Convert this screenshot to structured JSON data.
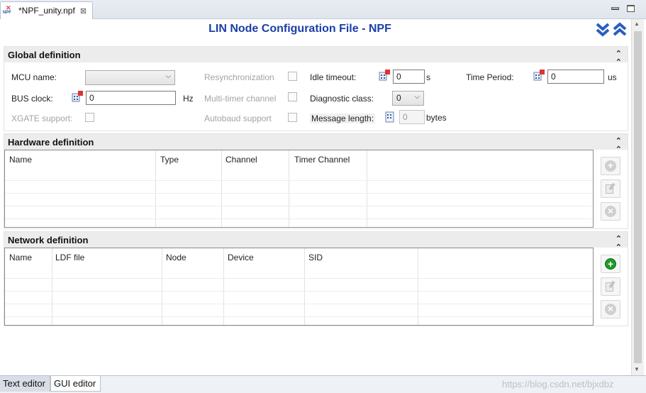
{
  "editor_tab": {
    "title": "*NPF_unity.npf",
    "icon_top": "✕",
    "icon_bottom": "NPF"
  },
  "header": {
    "title": "LIN Node Configuration File - NPF"
  },
  "global": {
    "title": "Global definition",
    "mcu_name_label": "MCU name:",
    "mcu_name_value": "",
    "bus_clock_label": "BUS clock:",
    "bus_clock_value": "0",
    "bus_clock_unit": "Hz",
    "xgate_label": "XGATE support:",
    "resync_label": "Resynchronization",
    "multitimer_label": "Multi-timer channel",
    "autobaud_label": "Autobaud support",
    "idle_label": "Idle timeout:",
    "idle_value": "0",
    "idle_unit": "s",
    "diag_label": "Diagnostic class:",
    "diag_value": "0",
    "msglen_label": "Message length:",
    "msglen_value": "0",
    "msglen_unit": "bytes",
    "time_period_label": "Time Period:",
    "time_period_value": "0",
    "time_period_unit": "us"
  },
  "hardware": {
    "title": "Hardware definition",
    "columns": [
      "Name",
      "Type",
      "Channel",
      "Timer Channel"
    ]
  },
  "network": {
    "title": "Network definition",
    "columns": [
      "Name",
      "LDF file",
      "Node",
      "Device",
      "SID"
    ]
  },
  "bottom_tabs": {
    "text_editor": "Text editor",
    "gui_editor": "GUI editor"
  },
  "watermark": "https://blog.csdn.net/bjxdbz",
  "colors": {
    "title_blue": "#1b3ea8",
    "add_green": "#1e9a2a"
  }
}
